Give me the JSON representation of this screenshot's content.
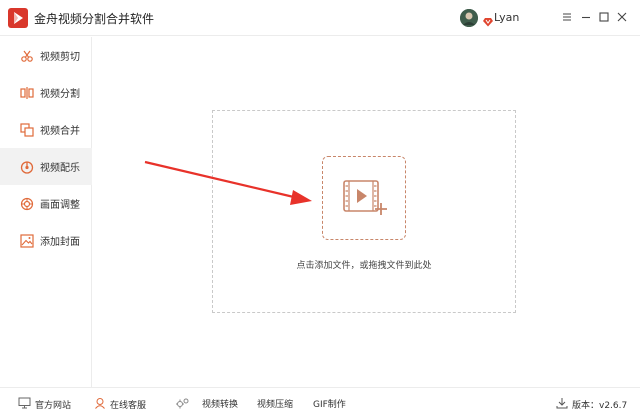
{
  "app": {
    "title": "金舟视频分割合并软件",
    "brand_color": "#d9372b",
    "accent_color": "#c8866a"
  },
  "user": {
    "name": "Lyan",
    "vip_icon": "diamond-icon"
  },
  "window_controls": [
    "menu-icon",
    "minimize-icon",
    "maximize-icon",
    "close-icon"
  ],
  "sidebar": {
    "active_index": 3,
    "items": [
      {
        "label": "视频剪切",
        "icon": "scissors-icon"
      },
      {
        "label": "视频分割",
        "icon": "split-icon"
      },
      {
        "label": "视频合并",
        "icon": "merge-icon"
      },
      {
        "label": "视频配乐",
        "icon": "music-disc-icon"
      },
      {
        "label": "画面调整",
        "icon": "adjust-icon"
      },
      {
        "label": "添加封面",
        "icon": "image-icon"
      }
    ]
  },
  "main": {
    "drop_hint": "点击添加文件，或拖拽文件到此处",
    "add_icon": "add-video-icon"
  },
  "footer": {
    "website": "官方网站",
    "support": "在线客服",
    "convert": "视频转换",
    "compress": "视频压缩",
    "gif": "GIF制作",
    "version": "版本：v2.6.7"
  }
}
